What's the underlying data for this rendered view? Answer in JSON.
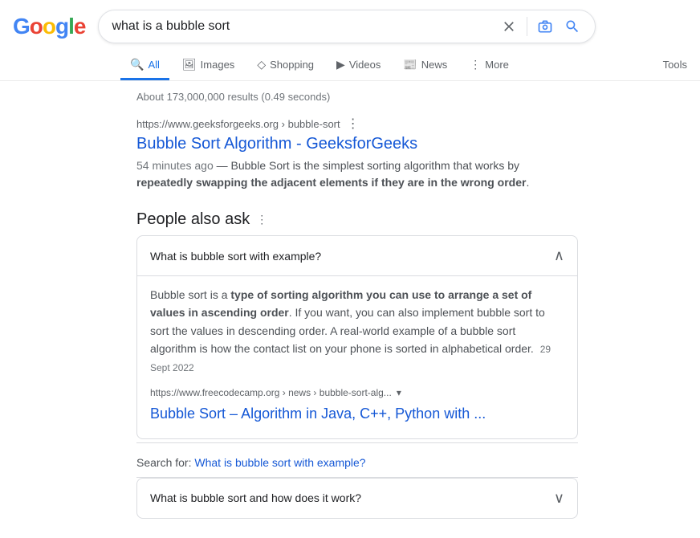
{
  "header": {
    "logo": {
      "letters": [
        "G",
        "o",
        "o",
        "g",
        "l",
        "e"
      ],
      "colors": [
        "#4285F4",
        "#EA4335",
        "#FBBC05",
        "#4285F4",
        "#34A853",
        "#EA4335"
      ]
    },
    "search": {
      "query": "what is a bubble sort",
      "clear_label": "Clear",
      "camera_label": "Search by image",
      "search_label": "Google Search"
    },
    "tabs": [
      {
        "id": "all",
        "label": "All",
        "icon": "🔍",
        "active": true
      },
      {
        "id": "images",
        "label": "Images",
        "icon": "🖼",
        "active": false
      },
      {
        "id": "shopping",
        "label": "Shopping",
        "icon": "◇",
        "active": false
      },
      {
        "id": "videos",
        "label": "Videos",
        "icon": "▶",
        "active": false
      },
      {
        "id": "news",
        "label": "News",
        "icon": "📰",
        "active": false
      },
      {
        "id": "more",
        "label": "More",
        "icon": "⋮",
        "active": false
      }
    ],
    "tools_label": "Tools"
  },
  "results": {
    "stats": "About 173,000,000 results (0.49 seconds)",
    "items": [
      {
        "url_domain": "https://www.geeksforgeeks.org",
        "url_path": " › bubble-sort",
        "title": "Bubble Sort Algorithm - GeeksforGeeks",
        "snippet_prefix": "54 minutes ago — Bubble Sort is the simplest sorting algorithm that works by ",
        "snippet_bold": "repeatedly swapping the adjacent elements if they are in the wrong order",
        "snippet_suffix": "."
      }
    ]
  },
  "people_also_ask": {
    "title": "People also ask",
    "items": [
      {
        "question": "What is bubble sort with example?",
        "expanded": true,
        "answer_prefix": "Bubble sort is a ",
        "answer_bold": "type of sorting algorithm you can use to arrange a set of values in ascending order",
        "answer_suffix": ". If you want, you can also implement bubble sort to sort the values in descending order. A real-world example of a bubble sort algorithm is how the contact list on your phone is sorted in alphabetical order.",
        "answer_date": "29 Sept 2022",
        "sub_result": {
          "url_domain": "https://www.freecodecamp.org",
          "url_path": " › news › bubble-sort-alg...",
          "title": "Bubble Sort – Algorithm in Java, C++, Python with ..."
        }
      },
      {
        "question": "What is bubble sort and how does it work?",
        "expanded": false
      }
    ],
    "search_for": {
      "prefix": "Search for: ",
      "link_text": "What is bubble sort with example?"
    }
  }
}
